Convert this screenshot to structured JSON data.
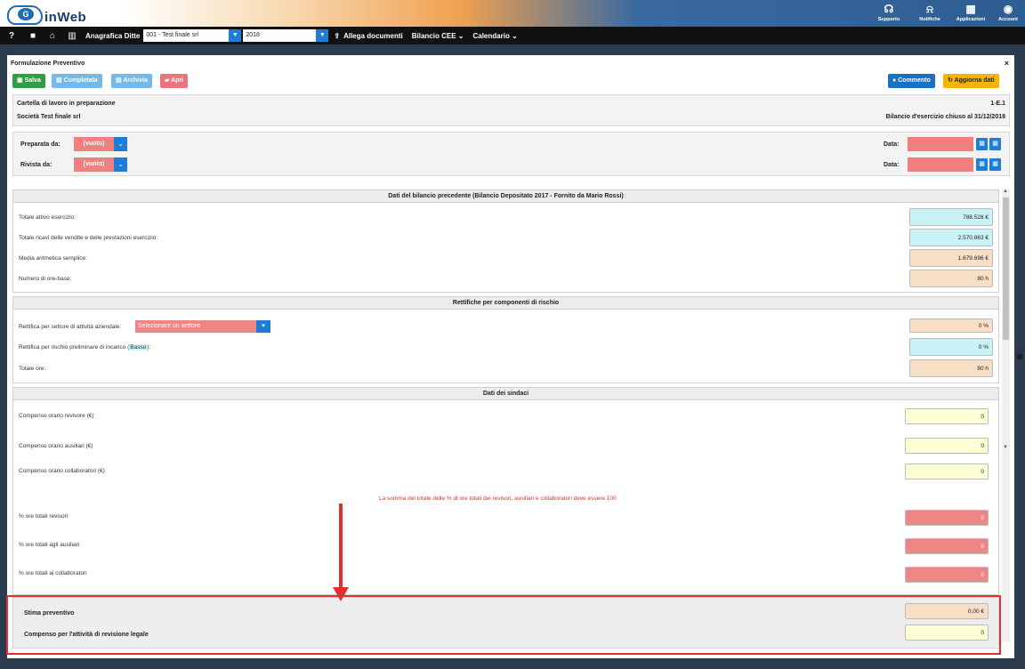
{
  "header": {
    "logo_text": "inWeb",
    "logo_mark": "G",
    "items": [
      {
        "label": "Supporto",
        "icon": "headset-icon",
        "glyph": "☊"
      },
      {
        "label": "Notifiche",
        "icon": "bell-icon",
        "glyph": "♫"
      },
      {
        "label": "Applicazioni",
        "icon": "grid-icon",
        "glyph": "▦"
      },
      {
        "label": "Account",
        "icon": "user-icon",
        "glyph": "●"
      }
    ]
  },
  "nav": {
    "help": "?",
    "anagrafica_label": "Anagrafica Ditte",
    "company_value": "001 - Test finale srl",
    "year_value": "2018",
    "allega": "Allega documenti",
    "bilancio": "Bilancio CEE",
    "calendario": "Calendario"
  },
  "panel": {
    "title": "Formulazione Preventivo",
    "close": "×",
    "buttons": {
      "salva": "Salva",
      "completata": "Completata",
      "archivia": "Archivia",
      "apri": "Apri",
      "commento": "Commento",
      "aggiorna": "Aggiorna dati"
    },
    "info": {
      "status": "Cartella di lavoro in preparazione",
      "company": "Società Test finale srl",
      "code": "1-E.1",
      "period": "Bilancio d'esercizio chiuso al 31/12/2018"
    },
    "prepared": {
      "preparata_label": "Preparata da:",
      "preparata_value": "(vuoto)",
      "rivista_label": "Rivista da:",
      "rivista_value": "(vuoto)",
      "data_label": "Data:"
    },
    "section1": {
      "title": "Dati del bilancio precedente (Bilancio Depositato 2017 - Fornito da Mario Rossi)",
      "rows": [
        {
          "label": "Totale attivo esercizio:",
          "value": "788.528 €"
        },
        {
          "label": "Totale ricavi delle vendite e delle prestazioni esercizio:",
          "value": "2.570.863 €"
        },
        {
          "label": "Media aritmetica semplice:",
          "value": "1.679.696 €"
        },
        {
          "label": "Numero di ore-base:",
          "value": "80 h"
        }
      ]
    },
    "section2": {
      "title": "Rettifiche per componenti di rischio",
      "sector_label": "Rettifica per settore di attività aziendale:",
      "sector_value": "Selezionare un settore",
      "risk_label_pre": "Rettifica per rischio preliminare di incarico (",
      "risk_level": "Basso",
      "risk_label_post": "):",
      "total_label": "Totale ore:",
      "sector_pct": "0 %",
      "risk_pct": "0 %",
      "total_value": "80 h"
    },
    "section3": {
      "title": "Dati dei sindaci",
      "rows": [
        {
          "label": "Compenso orario revisore (€)",
          "value": "0"
        },
        {
          "label": "Compenso orario ausiliari (€)",
          "value": "0"
        },
        {
          "label": "Compenso orario collaboratori (€)",
          "value": "0"
        }
      ],
      "warning": "La somma del totale delle % di ore totali dei revisori, ausiliari e collaboratori deve essere 100",
      "pct_rows": [
        {
          "label": "% ore totali revisori",
          "value": "0"
        },
        {
          "label": "% ore totali agli ausiliari",
          "value": "0"
        },
        {
          "label": "% ore totali ai collaboratori",
          "value": "0"
        }
      ]
    },
    "summary": {
      "stima_label": "Stima preventivo",
      "stima_value": "0,00 €",
      "compenso_label": "Compenso per l'attività di revisione legale",
      "compenso_value": "0"
    }
  },
  "colors": {
    "accent_blue": "#1c7ed6",
    "warning_red": "#e03131",
    "success_green": "#2f9e44"
  }
}
